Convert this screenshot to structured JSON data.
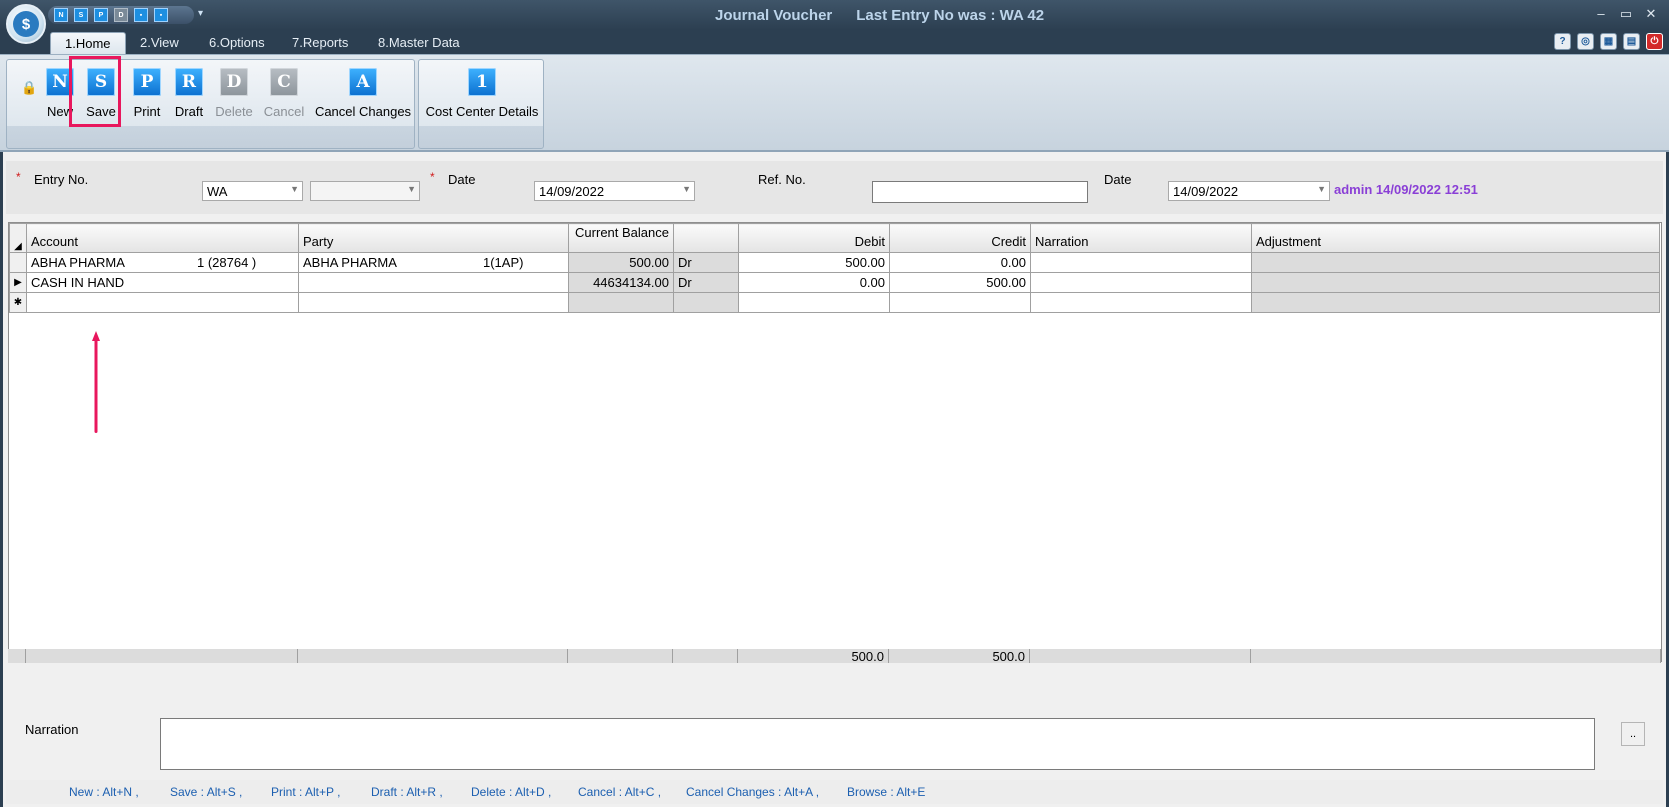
{
  "window": {
    "title": "Journal Voucher",
    "last_entry": "Last Entry No was : WA 42",
    "controls": [
      "–",
      "▭",
      "✕"
    ]
  },
  "quick_access": [
    "N",
    "S",
    "P",
    "D",
    "▪",
    "▪"
  ],
  "tabs": [
    {
      "label": "1.Home",
      "active": true
    },
    {
      "label": "2.View"
    },
    {
      "label": "6.Options"
    },
    {
      "label": "7.Reports"
    },
    {
      "label": "8.Master Data"
    }
  ],
  "ribbon": {
    "buttons": [
      {
        "id": "new",
        "glyph": "N",
        "label": "New",
        "disabled": false
      },
      {
        "id": "save",
        "glyph": "S",
        "label": "Save",
        "disabled": false
      },
      {
        "id": "print",
        "glyph": "P",
        "label": "Print",
        "disabled": false
      },
      {
        "id": "draft",
        "glyph": "R",
        "label": "Draft",
        "disabled": false
      },
      {
        "id": "delete",
        "glyph": "D",
        "label": "Delete",
        "disabled": true
      },
      {
        "id": "cancel",
        "glyph": "C",
        "label": "Cancel",
        "disabled": true
      },
      {
        "id": "cancel_changes",
        "glyph": "A",
        "label": "Cancel Changes",
        "disabled": false
      }
    ],
    "cost_center": {
      "glyph": "1",
      "label": "Cost Center Details"
    }
  },
  "header": {
    "entry_no_label": "Entry No.",
    "entry_prefix": "WA",
    "entry_number": "",
    "date_label": "Date",
    "date_value": "14/09/2022",
    "ref_label": "Ref. No.",
    "ref_value": "",
    "date2_label": "Date",
    "date2_value": "14/09/2022",
    "admin_stamp": "admin 14/09/2022 12:51"
  },
  "grid": {
    "columns": [
      "Account",
      "Party",
      "Current Balance",
      "",
      "Debit",
      "Credit",
      "Narration",
      "Adjustment"
    ],
    "rows": [
      {
        "marker": "",
        "account": "ABHA PHARMA",
        "account_code": "1 (28764 )",
        "party": "ABHA PHARMA",
        "party_code": "1(1AP)",
        "balance": "500.00",
        "drcr": "Dr",
        "debit": "500.00",
        "credit": "0.00",
        "narration": "",
        "adjustment": ""
      },
      {
        "marker": "▶",
        "account": "CASH IN HAND",
        "account_code": "",
        "party": "",
        "party_code": "",
        "balance": "44634134.00",
        "drcr": "Dr",
        "debit": "0.00",
        "credit": "500.00",
        "narration": "",
        "adjustment": ""
      },
      {
        "marker": "✱",
        "account": "",
        "account_code": "",
        "party": "",
        "party_code": "",
        "balance": "",
        "drcr": "",
        "debit": "",
        "credit": "",
        "narration": "",
        "adjustment": ""
      }
    ],
    "totals": {
      "debit": "500.0",
      "credit": "500.0"
    }
  },
  "narration": {
    "label": "Narration",
    "value": "",
    "button": ".."
  },
  "shortcuts": [
    "New : Alt+N ,",
    "Save : Alt+S ,",
    "Print : Alt+P ,",
    "Draft : Alt+R ,",
    "Delete : Alt+D ,",
    "Cancel : Alt+C ,",
    "Cancel Changes : Alt+A ,",
    "Browse : Alt+E"
  ],
  "colors": {
    "accent": "#1e8fe0",
    "highlight": "#e8175d",
    "stamp": "#8a3fd6",
    "shortcut": "#1c5fb0"
  }
}
